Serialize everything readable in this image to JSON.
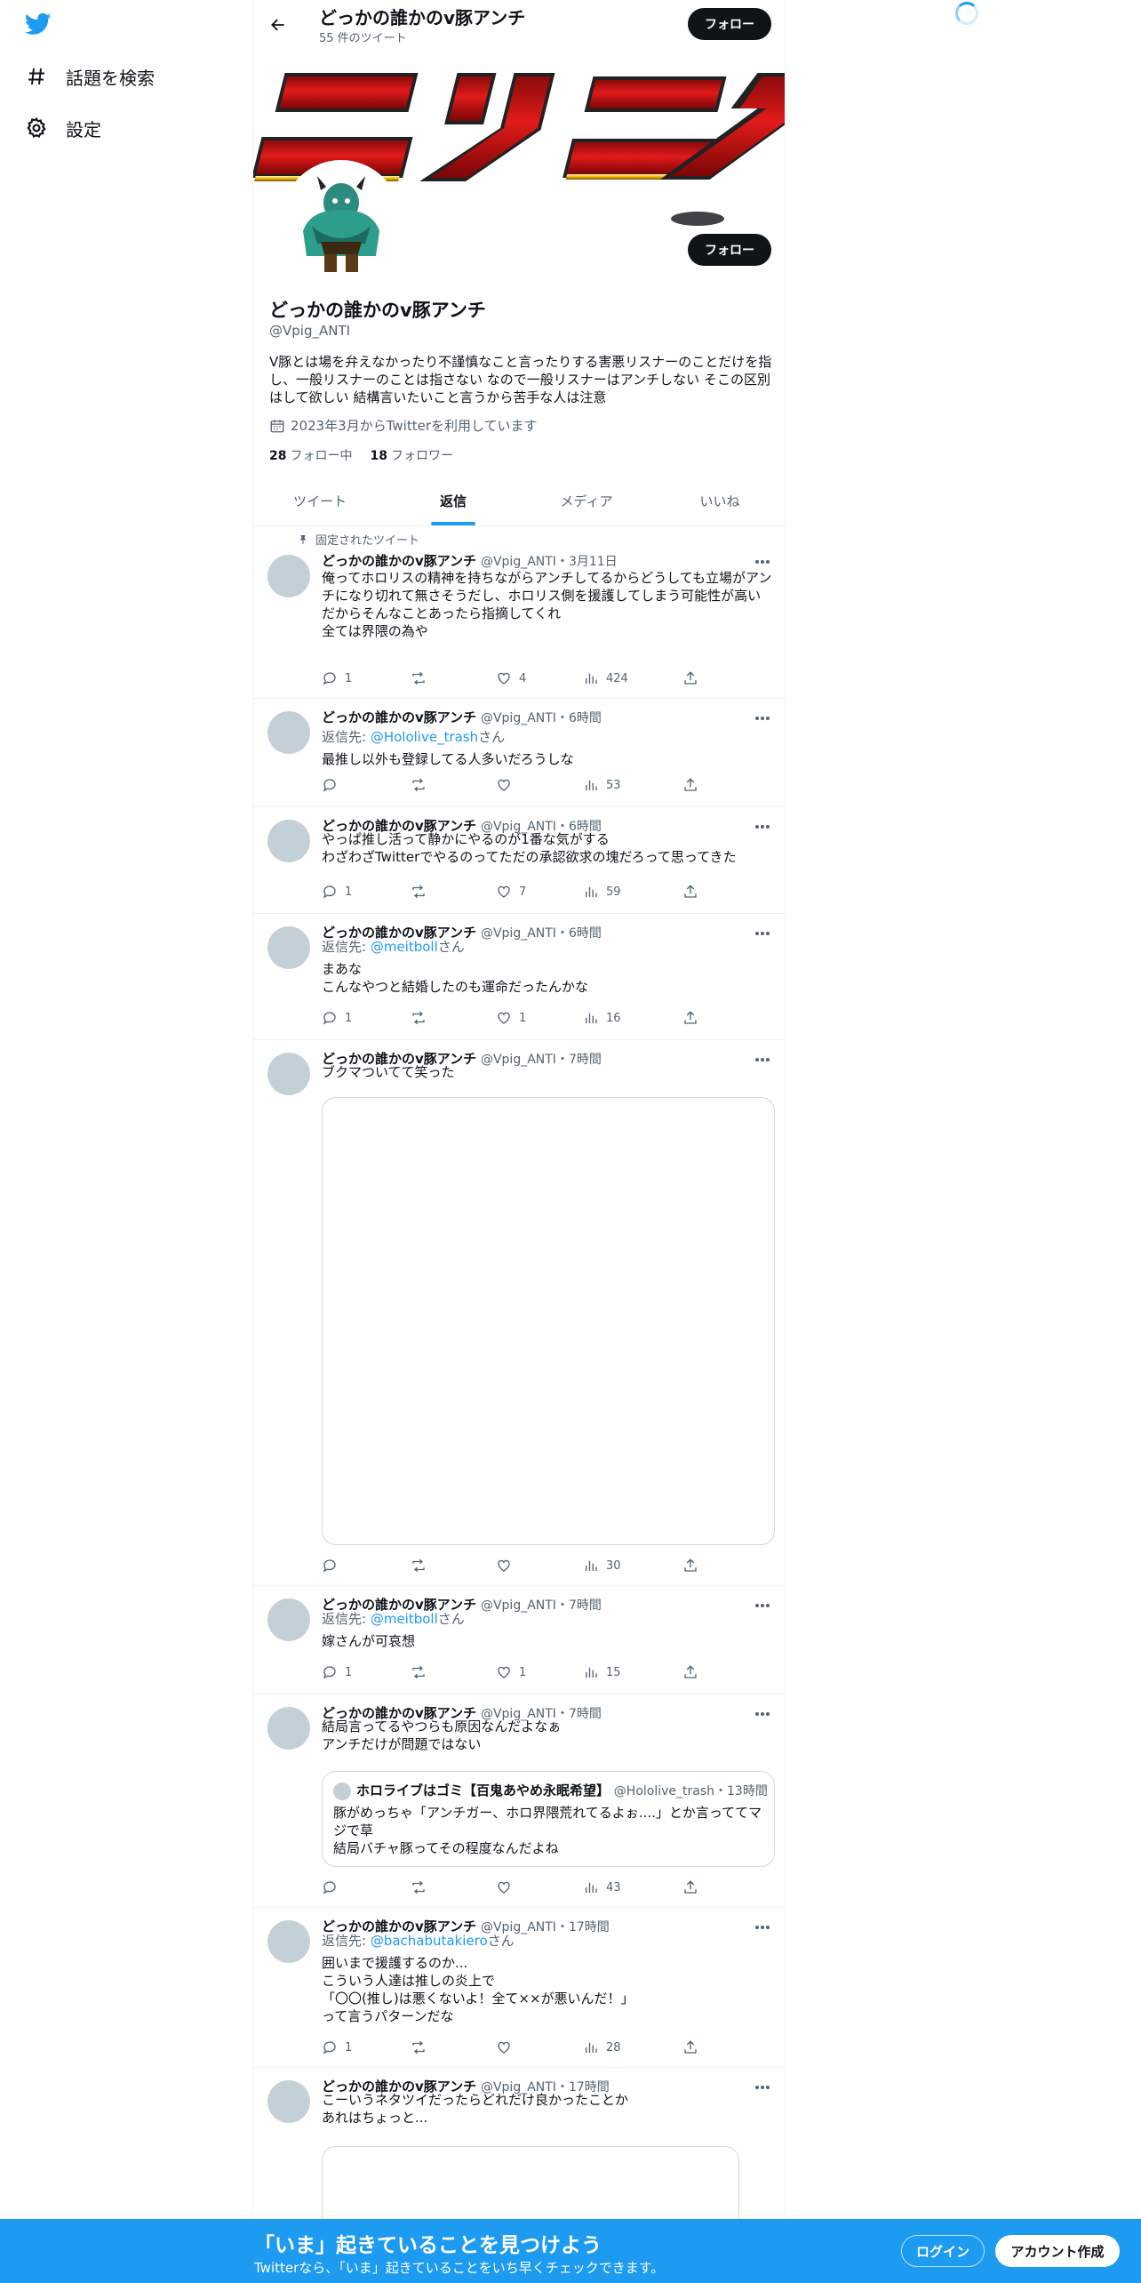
{
  "nav": {
    "explore_label": "話題を検索",
    "settings_label": "設定"
  },
  "header": {
    "name": "どっかの誰かのv豚アンチ",
    "tweet_count": "55 件のツイート",
    "follow_label": "フォロー"
  },
  "profile": {
    "name": "どっかの誰かのv豚アンチ",
    "handle": "@Vpig_ANTI",
    "bio": "V豚とは場を弁えなかったり不謹慎なこと言ったりする害悪リスナーのことだけを指し、一般リスナーのことは指さない なので一般リスナーはアンチしない そこの区別はして欲しい 結構言いたいこと言うから苦手な人は注意",
    "joined": "2023年3月からTwitterを利用しています",
    "following_count": "28",
    "following_label": "フォロー中",
    "followers_count": "18",
    "followers_label": "フォロワー",
    "follow_label": "フォロー",
    "banner_text": "ニンニク"
  },
  "tabs": [
    "ツイート",
    "返信",
    "メディア",
    "いいね"
  ],
  "active_tab": "返信",
  "pinned_label": "固定されたツイート",
  "tweets": [
    {
      "name": "どっかの誰かのv豚アンチ",
      "meta": "@Vpig_ANTI・3月11日",
      "lines": [
        "俺ってホロリスの精神を持ちながらアンチしてるからどうしても立場がアンチになり切れて無さそうだし、ホロリス側を援護してしまう可能性が高い",
        "だからそんなことあったら指摘してくれ",
        "全ては界隈の為や"
      ],
      "replies": "1",
      "retweets": "",
      "likes": "4",
      "views": "424"
    },
    {
      "name": "どっかの誰かのv豚アンチ",
      "meta": "@Vpig_ANTI・6時間",
      "reply_prefix": "返信先: ",
      "reply_to": "@Hololive_trash",
      "reply_suffix": "さん",
      "lines": [
        "最推し以外も登録してる人多いだろうしな"
      ],
      "replies": "",
      "retweets": "",
      "likes": "",
      "views": "53"
    },
    {
      "name": "どっかの誰かのv豚アンチ",
      "meta": "@Vpig_ANTI・6時間",
      "lines": [
        "やっぱ推し活って静かにやるのが1番な気がする",
        "わざわざTwitterでやるのってただの承認欲求の塊だろって思ってきた"
      ],
      "replies": "1",
      "retweets": "",
      "likes": "7",
      "views": "59"
    },
    {
      "name": "どっかの誰かのv豚アンチ",
      "meta": "@Vpig_ANTI・6時間",
      "reply_prefix": "返信先: ",
      "reply_to": "@meitboll",
      "reply_suffix": "さん",
      "lines": [
        "まあな",
        "こんなやつと結婚したのも運命だったんかな"
      ],
      "replies": "1",
      "retweets": "",
      "likes": "1",
      "views": "16"
    },
    {
      "name": "どっかの誰かのv豚アンチ",
      "meta": "@Vpig_ANTI・7時間",
      "lines": [
        "ブクマついてて笑った"
      ],
      "replies": "",
      "retweets": "",
      "likes": "",
      "views": "30"
    },
    {
      "name": "どっかの誰かのv豚アンチ",
      "meta": "@Vpig_ANTI・7時間",
      "reply_prefix": "返信先: ",
      "reply_to": "@meitboll",
      "reply_suffix": "さん",
      "lines": [
        "嫁さんが可哀想"
      ],
      "replies": "1",
      "retweets": "",
      "likes": "1",
      "views": "15"
    },
    {
      "name": "どっかの誰かのv豚アンチ",
      "meta": "@Vpig_ANTI・7時間",
      "lines": [
        "結局言ってるやつらも原因なんだよなぁ",
        "アンチだけが問題ではない"
      ],
      "quote": {
        "name": "ホロライブはゴミ【百鬼あやめ永眠希望】",
        "meta": "@Hololive_trash・13時間",
        "lines": [
          "豚がめっちゃ「アンチガー、ホロ界隈荒れてるよぉ....」とか言っててマジで草",
          "結局バチャ豚ってその程度なんだよね"
        ]
      },
      "replies": "",
      "retweets": "",
      "likes": "",
      "views": "43"
    },
    {
      "name": "どっかの誰かのv豚アンチ",
      "meta": "@Vpig_ANTI・17時間",
      "reply_prefix": "返信先: ",
      "reply_to": "@bachabutakiero",
      "reply_suffix": "さん",
      "lines": [
        "囲いまで援護するのか...",
        "こういう人達は推しの炎上で",
        "「〇〇(推し)は悪くないよ！全て××が悪いんだ！」",
        "って言うパターンだな"
      ],
      "replies": "1",
      "retweets": "",
      "likes": "",
      "views": "28"
    },
    {
      "name": "どっかの誰かのv豚アンチ",
      "meta": "@Vpig_ANTI・17時間",
      "lines": [
        "こーいうネタツイだったらどれだけ良かったことか",
        "あれはちょっと..."
      ]
    }
  ],
  "bottom_bar": {
    "title": "「いま」起きていることを見つけよう",
    "subtitle": "Twitterなら、「いま」起きていることをいち早くチェックできます。",
    "login_label": "ログイン",
    "signup_label": "アカウント作成"
  },
  "colors": {
    "accent": "#1d9bf0",
    "text": "#0f1419",
    "secondary": "#536471"
  }
}
